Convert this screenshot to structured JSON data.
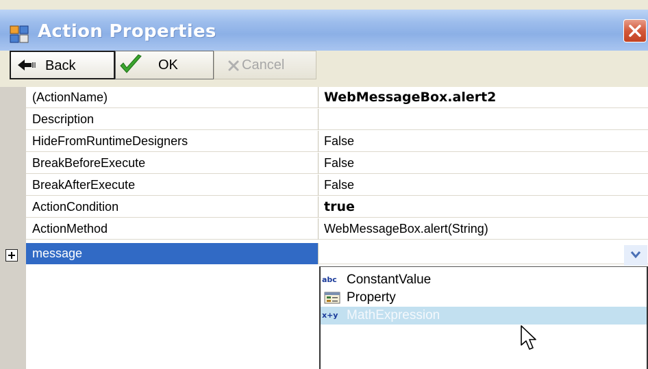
{
  "window": {
    "title": "Action Properties"
  },
  "toolbar": {
    "back_label": "Back",
    "ok_label": "OK",
    "cancel_label": "Cancel"
  },
  "properties": [
    {
      "name": "(ActionName)",
      "value": "WebMessageBox.alert2",
      "bold": true
    },
    {
      "name": "Description",
      "value": "",
      "bold": false
    },
    {
      "name": "HideFromRuntimeDesigners",
      "value": "False",
      "bold": false
    },
    {
      "name": "BreakBeforeExecute",
      "value": "False",
      "bold": false
    },
    {
      "name": "BreakAfterExecute",
      "value": "False",
      "bold": false
    },
    {
      "name": "ActionCondition",
      "value": "true",
      "bold": true
    },
    {
      "name": "ActionMethod",
      "value": "WebMessageBox.alert(String)",
      "bold": false
    },
    {
      "name": "message",
      "value": "",
      "bold": false,
      "selected": true,
      "expandable": true
    }
  ],
  "dropdown": {
    "items": [
      {
        "label": "ConstantValue",
        "icon": "abc-icon",
        "icon_text": "abc"
      },
      {
        "label": "Property",
        "icon": "property-icon",
        "icon_text": ""
      },
      {
        "label": "MathExpression",
        "icon": "math-expression-icon",
        "icon_text": "x+y",
        "highlighted": true
      }
    ]
  },
  "colors": {
    "selection": "#316ac5",
    "highlight": "#c2e0f0",
    "titlebar": "#9dbdec",
    "close": "#d3593b"
  }
}
